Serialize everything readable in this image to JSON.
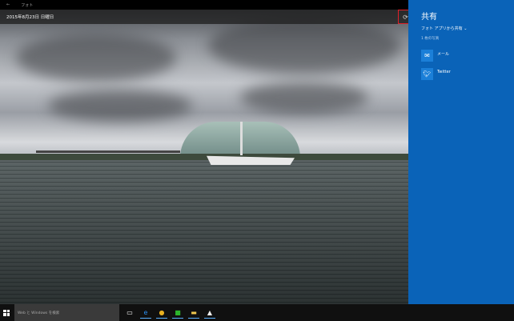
{
  "titlebar": {
    "back": "←",
    "app_name": "フォト"
  },
  "photo": {
    "date": "2015年8月23日 日曜日"
  },
  "share_panel": {
    "title": "共有",
    "source": "フォト アプリから共有",
    "source_chevron": "⌄",
    "count": "1 枚の写真",
    "apps": [
      {
        "label": "メール",
        "icon": "mail-icon"
      },
      {
        "label": "Twitter",
        "icon": "twitter-icon"
      }
    ]
  },
  "taskbar": {
    "search_placeholder": "Web と Windows を検索"
  },
  "colors": {
    "panel": "#0a63b8",
    "highlight": "#e0202a"
  }
}
